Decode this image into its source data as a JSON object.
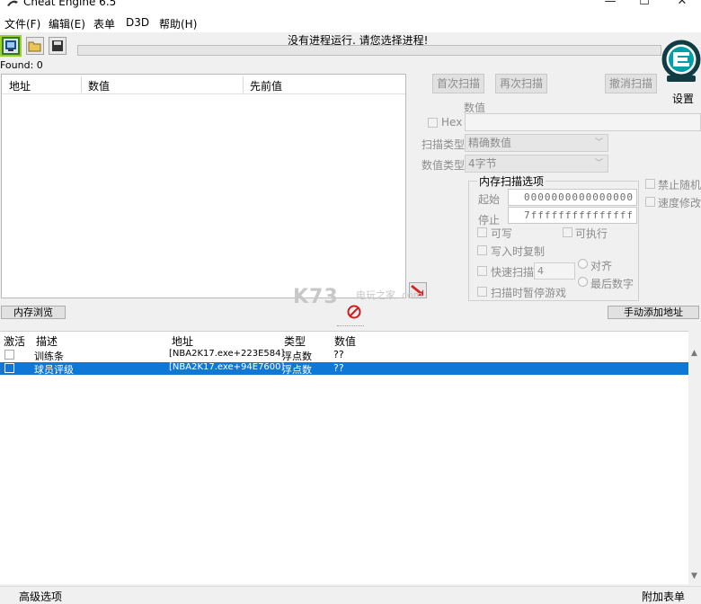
{
  "window": {
    "title": "Cheat Engine 6.5",
    "minimize": "—",
    "maximize": "☐",
    "close": "✕"
  },
  "menu": [
    "文件(F)",
    "编辑(E)",
    "表单",
    "D3D",
    "帮助(H)"
  ],
  "status": {
    "no_process": "没有进程运行. 请您选择进程!",
    "found": "Found: 0"
  },
  "results": {
    "columns": [
      "地址",
      "数值",
      "先前值"
    ]
  },
  "scan": {
    "first_scan": "首次扫描",
    "next_scan": "再次扫描",
    "undo_scan": "撤消扫描",
    "settings": "设置",
    "value_label": "数值",
    "hex_label": "Hex",
    "scan_type_label": "扫描类型",
    "scan_type_value": "精确数值",
    "value_type_label": "数值类型",
    "value_type_value": "4字节"
  },
  "memory_options": {
    "title": "内存扫描选项",
    "start_label": "起始",
    "start_value": "0000000000000000",
    "stop_label": "停止",
    "stop_value": "7fffffffffffffff",
    "writable": "可写",
    "executable": "可执行",
    "copy_on_write": "写入时复制",
    "fast_scan": "快速扫描",
    "fast_scan_value": "4",
    "align": "对齐",
    "last_digits": "最后数字",
    "pause_game": "扫描时暂停游戏"
  },
  "side_options": {
    "disable_random": "禁止随机",
    "speedhack": "速度修改"
  },
  "buttons": {
    "memory_view": "内存浏览",
    "add_address": "手动添加地址"
  },
  "watermark": {
    "main": "K73",
    "sub": "电玩之家 .com"
  },
  "table": {
    "columns": [
      "激活",
      "描述",
      "地址",
      "类型",
      "数值"
    ],
    "rows": [
      {
        "desc": "训练条",
        "address": "[NBA2K17.exe+223E584]",
        "type": "浮点数",
        "value": "??"
      },
      {
        "desc": "球员评级",
        "address": "[NBA2K17.exe+94E7600]",
        "type": "浮点数",
        "value": "??"
      }
    ]
  },
  "footer": {
    "advanced": "高级选项",
    "attach_table": "附加表单"
  },
  "colors": {
    "selection": "#0f78d7",
    "logo_teal": "#00a0a8"
  }
}
